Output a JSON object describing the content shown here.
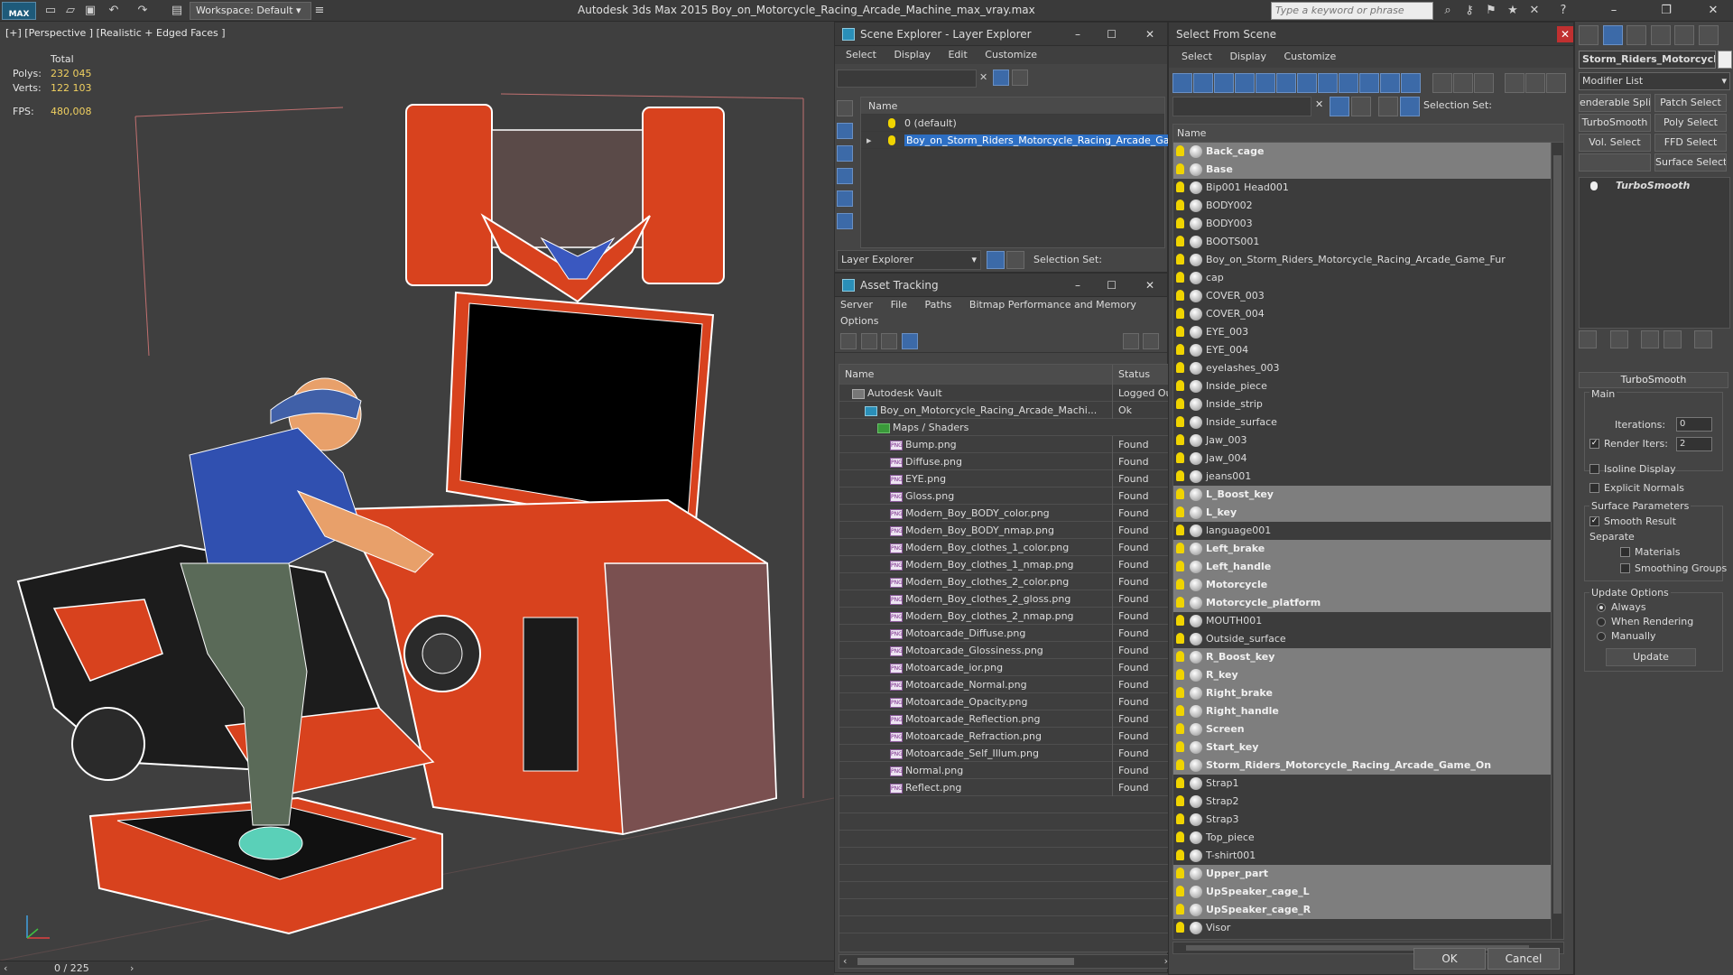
{
  "title_bar": {
    "logo_text": "MAX",
    "workspace_label": "Workspace: Default",
    "app_title": "Autodesk 3ds Max  2015     Boy_on_Motorcycle_Racing_Arcade_Machine_max_vray.max",
    "search_placeholder": "Type a keyword or phrase"
  },
  "viewport": {
    "label": "[+] [Perspective ] [Realistic + Edged Faces ]",
    "stats": {
      "total_label": "Total",
      "polys_label": "Polys:",
      "polys_value": "232 045",
      "verts_label": "Verts:",
      "verts_value": "122 103",
      "fps_label": "FPS:",
      "fps_value": "480,008"
    },
    "frame_counter": "0 / 225"
  },
  "scene_explorer": {
    "title": "Scene Explorer - Layer Explorer",
    "menu": [
      "Select",
      "Display",
      "Edit",
      "Customize"
    ],
    "column_name": "Name",
    "layers": [
      {
        "label": "0 (default)",
        "selected": false
      },
      {
        "label": "Boy_on_Storm_Riders_Motorcycle_Racing_Arcade_Game...",
        "selected": true
      }
    ],
    "footer_dropdown": "Layer Explorer",
    "selection_set_label": "Selection Set:"
  },
  "asset_tracking": {
    "title": "Asset Tracking",
    "menu_row1": [
      "Server",
      "File",
      "Paths",
      "Bitmap Performance and Memory"
    ],
    "menu_row2": [
      "Options"
    ],
    "col_name": "Name",
    "col_status": "Status",
    "rows": [
      {
        "name": "Autodesk Vault",
        "status": "Logged Out",
        "indent": 0,
        "kind": "vault"
      },
      {
        "name": "Boy_on_Motorcycle_Racing_Arcade_Machi...",
        "status": "Ok",
        "indent": 1,
        "kind": "max"
      },
      {
        "name": "Maps / Shaders",
        "status": "",
        "indent": 2,
        "kind": "folder"
      },
      {
        "name": "Bump.png",
        "status": "Found",
        "indent": 3,
        "kind": "png"
      },
      {
        "name": "Diffuse.png",
        "status": "Found",
        "indent": 3,
        "kind": "png"
      },
      {
        "name": "EYE.png",
        "status": "Found",
        "indent": 3,
        "kind": "png"
      },
      {
        "name": "Gloss.png",
        "status": "Found",
        "indent": 3,
        "kind": "png"
      },
      {
        "name": "Modern_Boy_BODY_color.png",
        "status": "Found",
        "indent": 3,
        "kind": "png"
      },
      {
        "name": "Modern_Boy_BODY_nmap.png",
        "status": "Found",
        "indent": 3,
        "kind": "png"
      },
      {
        "name": "Modern_Boy_clothes_1_color.png",
        "status": "Found",
        "indent": 3,
        "kind": "png"
      },
      {
        "name": "Modern_Boy_clothes_1_nmap.png",
        "status": "Found",
        "indent": 3,
        "kind": "png"
      },
      {
        "name": "Modern_Boy_clothes_2_color.png",
        "status": "Found",
        "indent": 3,
        "kind": "png"
      },
      {
        "name": "Modern_Boy_clothes_2_gloss.png",
        "status": "Found",
        "indent": 3,
        "kind": "png"
      },
      {
        "name": "Modern_Boy_clothes_2_nmap.png",
        "status": "Found",
        "indent": 3,
        "kind": "png"
      },
      {
        "name": "Motoarcade_Diffuse.png",
        "status": "Found",
        "indent": 3,
        "kind": "png"
      },
      {
        "name": "Motoarcade_Glossiness.png",
        "status": "Found",
        "indent": 3,
        "kind": "png"
      },
      {
        "name": "Motoarcade_ior.png",
        "status": "Found",
        "indent": 3,
        "kind": "png"
      },
      {
        "name": "Motoarcade_Normal.png",
        "status": "Found",
        "indent": 3,
        "kind": "png"
      },
      {
        "name": "Motoarcade_Opacity.png",
        "status": "Found",
        "indent": 3,
        "kind": "png"
      },
      {
        "name": "Motoarcade_Reflection.png",
        "status": "Found",
        "indent": 3,
        "kind": "png"
      },
      {
        "name": "Motoarcade_Refraction.png",
        "status": "Found",
        "indent": 3,
        "kind": "png"
      },
      {
        "name": "Motoarcade_Self_Illum.png",
        "status": "Found",
        "indent": 3,
        "kind": "png"
      },
      {
        "name": "Normal.png",
        "status": "Found",
        "indent": 3,
        "kind": "png"
      },
      {
        "name": "Reflect.png",
        "status": "Found",
        "indent": 3,
        "kind": "png"
      }
    ]
  },
  "select_from_scene": {
    "title": "Select From Scene",
    "menu": [
      "Select",
      "Display",
      "Customize"
    ],
    "selection_set_label": "Selection Set:",
    "column_name": "Name",
    "items": [
      {
        "label": "Back_cage",
        "selected": true
      },
      {
        "label": "Base",
        "selected": true
      },
      {
        "label": "Bip001 Head001",
        "selected": false
      },
      {
        "label": "BODY002",
        "selected": false
      },
      {
        "label": "BODY003",
        "selected": false
      },
      {
        "label": "BOOTS001",
        "selected": false
      },
      {
        "label": "Boy_on_Storm_Riders_Motorcycle_Racing_Arcade_Game_Fur",
        "selected": false
      },
      {
        "label": "cap",
        "selected": false
      },
      {
        "label": "COVER_003",
        "selected": false
      },
      {
        "label": "COVER_004",
        "selected": false
      },
      {
        "label": "EYE_003",
        "selected": false
      },
      {
        "label": "EYE_004",
        "selected": false
      },
      {
        "label": "eyelashes_003",
        "selected": false
      },
      {
        "label": "Inside_piece",
        "selected": false
      },
      {
        "label": "Inside_strip",
        "selected": false
      },
      {
        "label": "Inside_surface",
        "selected": false
      },
      {
        "label": "Jaw_003",
        "selected": false
      },
      {
        "label": "Jaw_004",
        "selected": false
      },
      {
        "label": "jeans001",
        "selected": false
      },
      {
        "label": "L_Boost_key",
        "selected": true
      },
      {
        "label": "L_key",
        "selected": true
      },
      {
        "label": "language001",
        "selected": false
      },
      {
        "label": "Left_brake",
        "selected": true
      },
      {
        "label": "Left_handle",
        "selected": true
      },
      {
        "label": "Motorcycle",
        "selected": true
      },
      {
        "label": "Motorcycle_platform",
        "selected": true
      },
      {
        "label": "MOUTH001",
        "selected": false
      },
      {
        "label": "Outside_surface",
        "selected": false
      },
      {
        "label": "R_Boost_key",
        "selected": true
      },
      {
        "label": "R_key",
        "selected": true
      },
      {
        "label": "Right_brake",
        "selected": true
      },
      {
        "label": "Right_handle",
        "selected": true
      },
      {
        "label": "Screen",
        "selected": true
      },
      {
        "label": "Start_key",
        "selected": true
      },
      {
        "label": "Storm_Riders_Motorcycle_Racing_Arcade_Game_On",
        "selected": true
      },
      {
        "label": "Strap1",
        "selected": false
      },
      {
        "label": "Strap2",
        "selected": false
      },
      {
        "label": "Strap3",
        "selected": false
      },
      {
        "label": "Top_piece",
        "selected": false
      },
      {
        "label": "T-shirt001",
        "selected": false
      },
      {
        "label": "Upper_part",
        "selected": true
      },
      {
        "label": "UpSpeaker_cage_L",
        "selected": true
      },
      {
        "label": "UpSpeaker_cage_R",
        "selected": true
      },
      {
        "label": "Visor",
        "selected": false
      }
    ],
    "ok_label": "OK",
    "cancel_label": "Cancel"
  },
  "command_panel": {
    "object_name": "Storm_Riders_Motorcycl",
    "modifier_list": "Modifier List",
    "buttons": [
      "enderable Spli",
      "Patch Select",
      "TurboSmooth",
      "Poly Select",
      "Vol. Select",
      "FFD Select",
      "",
      "Surface Select"
    ],
    "stack_item": "TurboSmooth",
    "rollout_title": "TurboSmooth",
    "main_label": "Main",
    "iterations_label": "Iterations:",
    "iterations_value": "0",
    "render_iters_label": "Render Iters:",
    "render_iters_value": "2",
    "isoline_label": "Isoline Display",
    "explicit_normals_label": "Explicit Normals",
    "surface_params_label": "Surface Parameters",
    "smooth_result_label": "Smooth Result",
    "separate_label": "Separate",
    "materials_label": "Materials",
    "smoothing_groups_label": "Smoothing Groups",
    "update_options_label": "Update Options",
    "always_label": "Always",
    "when_rendering_label": "When Rendering",
    "manually_label": "Manually",
    "update_button": "Update"
  },
  "colors": {
    "selection_blue": "#2d6fc4",
    "selected_row": "#7e7e7e",
    "wire_white": "#ffffff",
    "arcade_red": "#d8421e",
    "shirt_blue": "#3050b0",
    "bulb_yellow": "#f0d400"
  }
}
